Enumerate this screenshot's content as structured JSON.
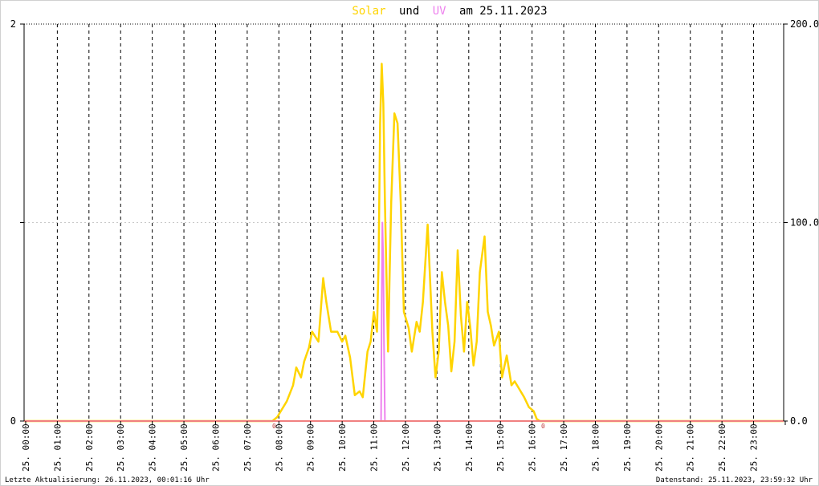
{
  "title": {
    "solar_word": "Solar",
    "und_word": "und",
    "uv_word": "UV",
    "date_phrase": "am 25.11.2023"
  },
  "colors": {
    "background": "#ffffff",
    "frame": "#000000",
    "grid_major": "#000000",
    "grid_minor": "#c8c8c8",
    "solar": "#ffd400",
    "uv": "#ee82ee",
    "baseline": "#f08080",
    "text": "#000000"
  },
  "footer": {
    "left": "Letzte Aktualisierung: 26.11.2023, 00:01:16 Uhr",
    "right": "Datenstand: 25.11.2023, 23:59:32 Uhr"
  },
  "chart_data": {
    "type": "line",
    "x_unit": "hour of day",
    "xlim": [
      0,
      24
    ],
    "x_tick_labels": [
      "25. 00:00",
      "25. 01:00",
      "25. 02:00",
      "25. 03:00",
      "25. 04:00",
      "25. 05:00",
      "25. 06:00",
      "25. 07:00",
      "25. 08:00",
      "25. 09:00",
      "25. 10:00",
      "25. 11:00",
      "25. 12:00",
      "25. 13:00",
      "25. 14:00",
      "25. 15:00",
      "25. 16:00",
      "25. 17:00",
      "25. 18:00",
      "25. 19:00",
      "25. 20:00",
      "25. 21:00",
      "25. 22:00",
      "25. 23:00"
    ],
    "y_left": {
      "ylim": [
        0,
        2
      ],
      "tick_labels": [
        "0",
        "2"
      ]
    },
    "y_right": {
      "ylim": [
        0,
        200
      ],
      "tick_labels": [
        "0.0",
        "100.0",
        "200.0"
      ]
    },
    "grid": true,
    "min_max_markers": [
      {
        "x": 7.9,
        "label": "0"
      },
      {
        "x": 16.4,
        "label": "0"
      }
    ],
    "series": [
      {
        "axis": "right",
        "color": "#ffd400",
        "x": [
          0,
          7.85,
          8.0,
          8.3,
          8.5,
          8.6,
          8.75,
          8.85,
          9.0,
          9.1,
          9.3,
          9.45,
          9.55,
          9.7,
          9.9,
          10.05,
          10.15,
          10.3,
          10.45,
          10.6,
          10.7,
          10.85,
          10.95,
          11.05,
          11.15,
          11.2,
          11.25,
          11.3,
          11.35,
          11.4,
          11.5,
          11.55,
          11.6,
          11.7,
          11.8,
          11.9,
          12.0,
          12.15,
          12.25,
          12.4,
          12.5,
          12.6,
          12.75,
          12.9,
          13.0,
          13.1,
          13.2,
          13.3,
          13.4,
          13.5,
          13.6,
          13.7,
          13.8,
          13.9,
          14.0,
          14.1,
          14.2,
          14.3,
          14.4,
          14.55,
          14.65,
          14.75,
          14.85,
          15.0,
          15.1,
          15.25,
          15.4,
          15.5,
          15.65,
          15.8,
          15.95,
          16.1,
          16.2,
          16.3,
          24
        ],
        "values": [
          0,
          0,
          2,
          10,
          18,
          27,
          22,
          30,
          37,
          45,
          40,
          72,
          60,
          45,
          45,
          40,
          43,
          32,
          13,
          15,
          12,
          35,
          40,
          55,
          45,
          80,
          150,
          180,
          160,
          110,
          35,
          75,
          110,
          155,
          150,
          110,
          55,
          47,
          35,
          50,
          45,
          60,
          99,
          45,
          22,
          35,
          75,
          60,
          48,
          25,
          40,
          86,
          53,
          35,
          60,
          47,
          28,
          40,
          75,
          93,
          55,
          48,
          38,
          45,
          22,
          33,
          18,
          20,
          16,
          12,
          7,
          5,
          1,
          0,
          0
        ]
      },
      {
        "axis": "right",
        "color": "#ee82ee",
        "x": [
          0,
          11.28,
          11.3,
          11.32,
          11.35,
          11.37,
          11.4,
          24
        ],
        "values": [
          0,
          0,
          60,
          100,
          80,
          40,
          0,
          0
        ]
      }
    ]
  }
}
